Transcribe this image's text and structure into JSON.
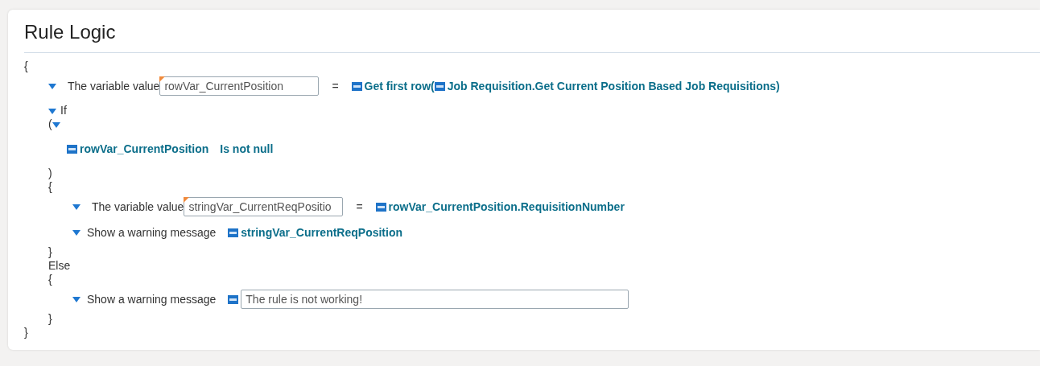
{
  "panel": {
    "title": "Rule Logic"
  },
  "lines": [
    {
      "kind": "text",
      "text": "{"
    },
    {
      "kind": "block",
      "children": [
        {
          "kind": "assign",
          "expanded": true,
          "label": "The variable value",
          "field": {
            "value": "rowVar_CurrentPosition",
            "flagged": true
          },
          "operator": "=",
          "tokens": [
            {
              "kind": "variable",
              "text": "Get first row("
            },
            {
              "kind": "variable",
              "text": "Job Requisition.Get Current Position Based Job Requisitions"
            },
            {
              "kind": "link",
              "text": ")"
            }
          ]
        },
        {
          "kind": "if",
          "expanded": true,
          "label": "If",
          "children": [
            {
              "kind": "paren",
              "expanded": true,
              "text": "(",
              "children": [
                {
                  "kind": "condition",
                  "tokens": [
                    {
                      "kind": "variable",
                      "text": "rowVar_CurrentPosition"
                    },
                    {
                      "kind": "link",
                      "text": "Is not null"
                    }
                  ]
                }
              ]
            },
            {
              "kind": "text",
              "text": ")"
            },
            {
              "kind": "text",
              "text": "{"
            },
            {
              "kind": "block",
              "children": [
                {
                  "kind": "assign",
                  "expanded": true,
                  "label": "The variable value",
                  "field": {
                    "value": "stringVar_CurrentReqPositio",
                    "flagged": true
                  },
                  "operator": "=",
                  "tokens": [
                    {
                      "kind": "variable",
                      "text": "rowVar_CurrentPosition.RequisitionNumber"
                    }
                  ]
                },
                {
                  "kind": "message",
                  "expanded": true,
                  "label": "Show a warning message",
                  "tokens": [
                    {
                      "kind": "variable",
                      "text": "stringVar_CurrentReqPosition"
                    }
                  ]
                }
              ]
            },
            {
              "kind": "text",
              "text": "}"
            },
            {
              "kind": "text",
              "text": "Else"
            },
            {
              "kind": "text",
              "text": "{"
            },
            {
              "kind": "block",
              "children": [
                {
                  "kind": "message",
                  "expanded": true,
                  "label": "Show a warning message",
                  "tokens": [
                    {
                      "kind": "input",
                      "text": "The rule is not working!"
                    }
                  ]
                }
              ]
            },
            {
              "kind": "text",
              "text": "}"
            }
          ]
        }
      ]
    },
    {
      "kind": "text",
      "text": "}"
    }
  ]
}
